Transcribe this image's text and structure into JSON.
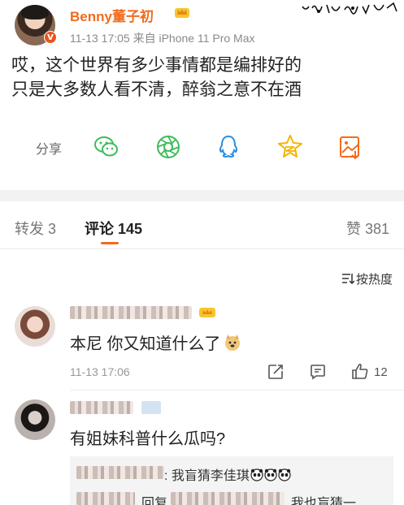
{
  "post": {
    "username": "Benny董子初",
    "verified_badge": "V",
    "meta": "11-13 17:05  来自 iPhone 11 Pro Max",
    "content_lines": [
      "哎，这个世界有多少事情都是编排好的",
      "只是大多数人看不清，醉翁之意不在酒"
    ],
    "share_label": "分享",
    "share_icons": [
      "wechat-icon",
      "moments-icon",
      "qq-icon",
      "qzone-star-icon",
      "save-image-icon"
    ]
  },
  "tabs": {
    "reposts": "转发 3",
    "comments": "评论 145",
    "likes": "赞 381"
  },
  "sort_label": "按热度",
  "comments": [
    {
      "text": "本尼 你又知道什么了",
      "emoji": "doge-emoji",
      "time": "11-13 17:06",
      "like_count": "12"
    },
    {
      "text": "有姐妹科普什么瓜吗?",
      "replies": [
        {
          "text": ": 我盲猜李佳琪",
          "emojis": [
            "panda-emoji",
            "panda-emoji",
            "panda-emoji"
          ]
        },
        {
          "prefix": "回复",
          "text": "我也盲猜一"
        }
      ]
    }
  ],
  "colors": {
    "accent_orange": "#f26b1d",
    "share_green": "#3dbb5a",
    "share_yellow": "#f4b400",
    "share_blue": "#2b8ee0"
  }
}
